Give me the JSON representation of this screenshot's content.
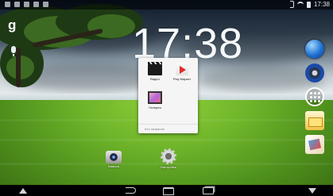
{
  "status_bar": {
    "time": "17:38"
  },
  "google_search": {
    "logo_text": "g"
  },
  "clock": {
    "time": "17:38"
  },
  "folder": {
    "name": "Без названия",
    "apps": [
      {
        "label": "Видео",
        "icon": "video-clapper-icon"
      },
      {
        "label": "Play Маркет",
        "icon": "play-store-icon"
      },
      {
        "label": "Галерея",
        "icon": "gallery-icon"
      }
    ]
  },
  "shortcuts": [
    {
      "label": "Камера",
      "icon": "camera-icon"
    },
    {
      "label": "Настройки",
      "icon": "settings-gear-icon"
    }
  ],
  "dock": [
    {
      "icon": "browser-globe-icon"
    },
    {
      "icon": "music-speaker-icon"
    },
    {
      "icon": "all-apps-grid-icon"
    },
    {
      "icon": "email-icon"
    },
    {
      "icon": "gallery-icon"
    }
  ],
  "navigation": [
    "up-arrow-icon",
    "back-icon",
    "home-icon",
    "recent-apps-icon",
    "down-arrow-icon"
  ],
  "colors": {
    "popup_bg": "#f5f5f5",
    "status_bar": "#000000",
    "grass": "#6fb52a"
  }
}
